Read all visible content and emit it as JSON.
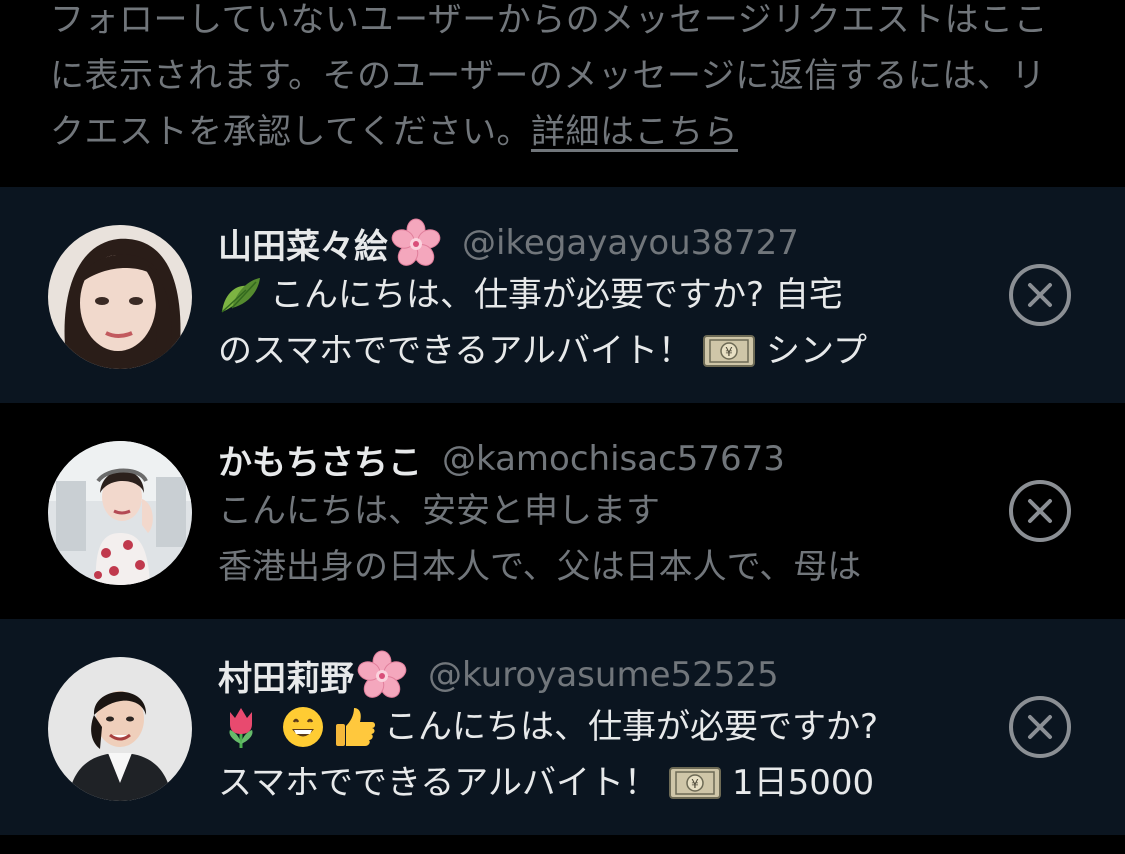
{
  "notice": {
    "text": "フォローしていないユーザーからのメッセージリクエストはここに表示されます。そのユーザーのメッセージに返信するには、リクエストを承認してください。",
    "link": "詳細はこちら"
  },
  "requests": [
    {
      "display_name": "山田菜々絵",
      "name_emoji": "cherry-blossom-icon",
      "handle": "@ikegayayou38727",
      "preview_line1": "こんにちは、仕事が必要ですか? 自宅",
      "preview_line2_a": "のスマホでできるアルバイト！",
      "preview_line2_b": "シンプ",
      "leading_emoji": "leaf-icon",
      "inline_emoji": "yen-banknote-icon",
      "unread": true
    },
    {
      "display_name": "かもちさちこ",
      "handle": "@kamochisac57673",
      "preview_line1": "こんにちは、安安と申します",
      "preview_line2": "香港出身の日本人で、父は日本人で、母は",
      "unread": false
    },
    {
      "display_name": "村田莉野",
      "name_emoji": "cherry-blossom-icon",
      "handle": "@kuroyasume52525",
      "preview_line1": "こんにちは、仕事が必要ですか?",
      "preview_line2_a": "スマホでできるアルバイト！",
      "preview_line2_b": "1日5000",
      "leading_emojis": [
        "tulip-icon",
        "grinning-face-icon",
        "thumbs-up-icon"
      ],
      "inline_emoji": "yen-banknote-icon",
      "unread": true
    }
  ],
  "colors": {
    "background": "#000000",
    "unread_row": "#0b1520",
    "primary_text": "#e7e9ea",
    "secondary_text": "#71767b"
  }
}
